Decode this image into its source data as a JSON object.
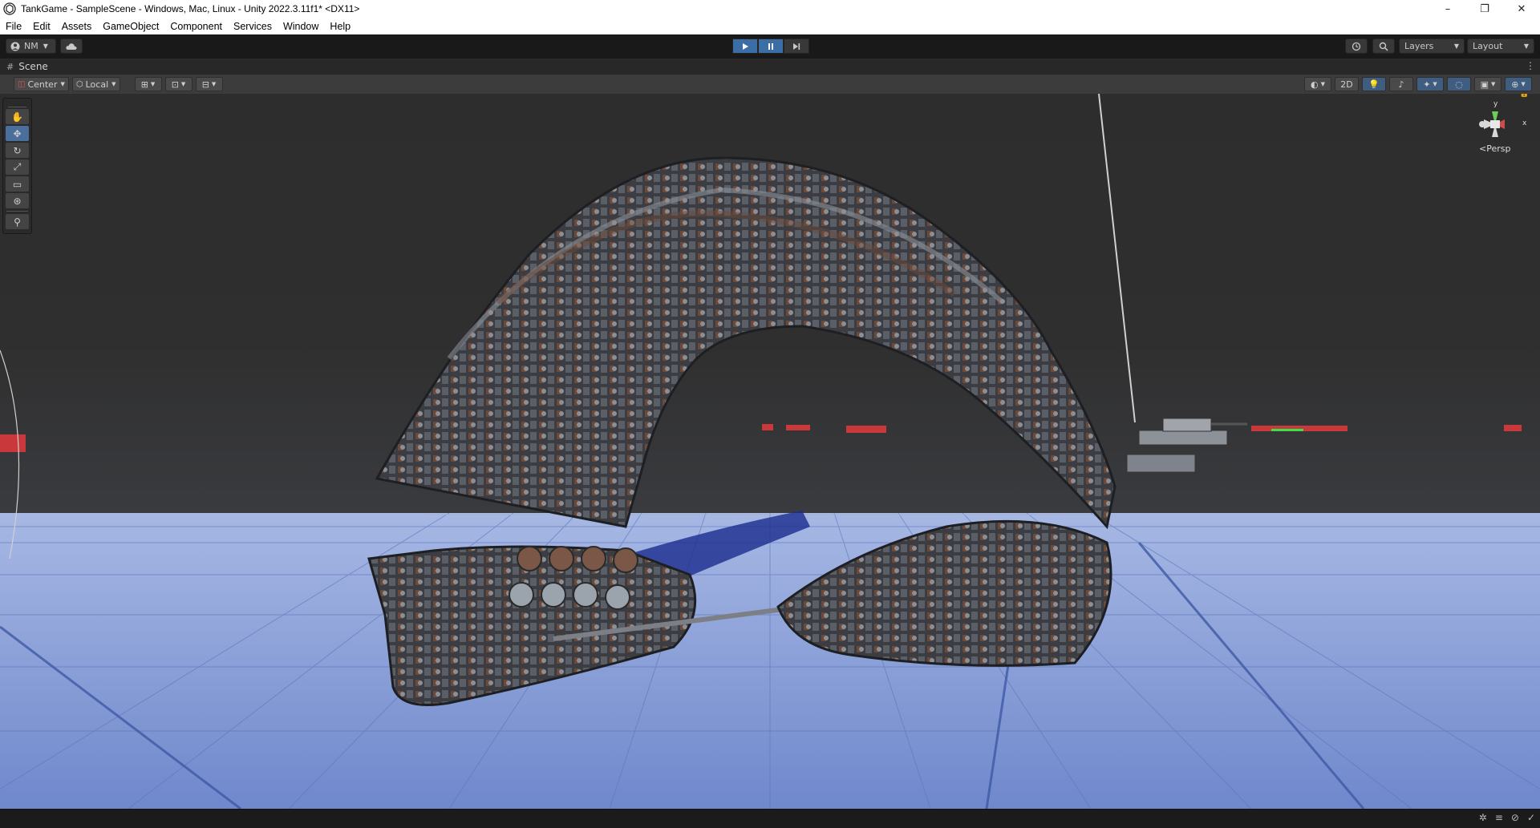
{
  "window": {
    "title": "TankGame - SampleScene - Windows, Mac, Linux - Unity 2022.3.11f1* <DX11>",
    "controls": {
      "minimize": "–",
      "maximize": "❐",
      "close": "✕"
    }
  },
  "menu": [
    "File",
    "Edit",
    "Assets",
    "GameObject",
    "Component",
    "Services",
    "Window",
    "Help"
  ],
  "toolbar": {
    "account_label": "NM",
    "layers_label": "Layers",
    "layout_label": "Layout"
  },
  "scene_tab": {
    "label": "Scene"
  },
  "scene_toolbar": {
    "pivot_label": "Center",
    "space_label": "Local",
    "mode_2d_label": "2D"
  },
  "gizmo": {
    "projection_label": "Persp",
    "x_label": "x",
    "y_label": "y"
  },
  "icons": {
    "play": "play-icon",
    "pause": "pause-icon",
    "step": "step-icon",
    "history": "history-icon",
    "search": "search-icon",
    "cloud": "cloud-icon",
    "hand": "hand-icon",
    "move": "move-icon",
    "rotate": "rotate-icon",
    "scale": "scale-icon",
    "rect": "rect-icon",
    "transform": "transform-icon",
    "custom": "custom-tool-icon"
  },
  "colors": {
    "sky": "#2f2f2f",
    "ground": "#7f97d6",
    "accent": "#3a6ea5"
  }
}
